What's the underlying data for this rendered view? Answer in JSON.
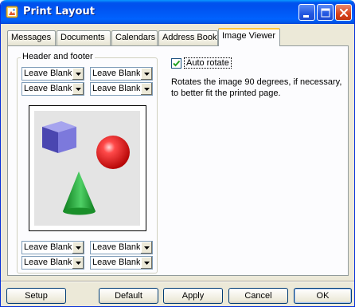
{
  "window": {
    "title": "Print Layout"
  },
  "tabs": [
    {
      "label": "Messages"
    },
    {
      "label": "Documents"
    },
    {
      "label": "Calendars"
    },
    {
      "label": "Address Book"
    },
    {
      "label": "Image Viewer",
      "active": true
    }
  ],
  "header_footer": {
    "label": "Header and footer",
    "top_combos": [
      "Leave Blank",
      "Leave Blank",
      "Leave Blank",
      "Leave Blank"
    ],
    "bottom_combos": [
      "Leave Blank",
      "Leave Blank",
      "Leave Blank",
      "Leave Blank"
    ]
  },
  "auto_rotate": {
    "label": "Auto rotate",
    "checked": true,
    "description": "Rotates the image 90 degrees, if necessary, to better fit the printed page."
  },
  "buttons": {
    "setup": "Setup",
    "default": "Default",
    "apply": "Apply",
    "cancel": "Cancel",
    "ok": "OK"
  },
  "colors": {
    "titlebar": "#0058f5",
    "dialog_bg": "#ece9d8",
    "cube": "#6a68cc",
    "sphere": "#ff2a2a",
    "cone": "#2aa63a"
  }
}
